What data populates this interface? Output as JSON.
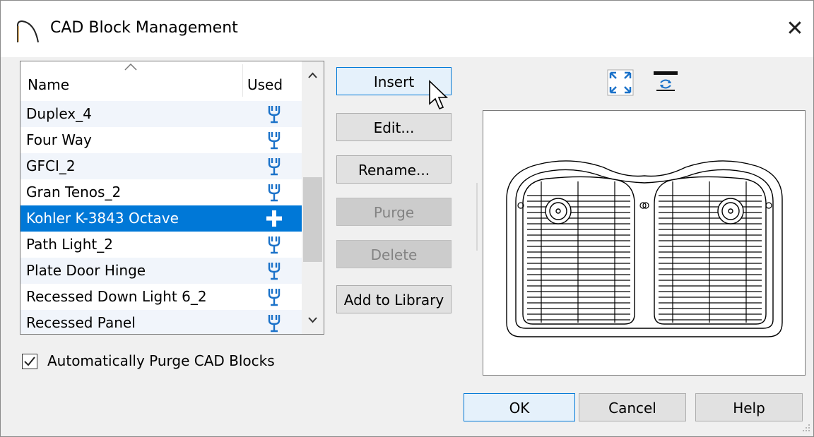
{
  "window": {
    "title": "CAD Block Management",
    "close_glyph": "✕"
  },
  "list": {
    "columns": {
      "name": "Name",
      "used": "Used"
    },
    "rows": [
      {
        "name": "Duplex_4",
        "used_icon": "wrench-used-icon"
      },
      {
        "name": "Four Way",
        "used_icon": "wrench-used-icon"
      },
      {
        "name": "GFCI_2",
        "used_icon": "wrench-used-icon"
      },
      {
        "name": "Gran Tenos_2",
        "used_icon": "wrench-used-icon"
      },
      {
        "name": "Kohler K-3843 Octave",
        "used_icon": "plus-unused-icon",
        "selected": true
      },
      {
        "name": "Path Light_2",
        "used_icon": "wrench-used-icon"
      },
      {
        "name": "Plate Door Hinge",
        "used_icon": "wrench-used-icon"
      },
      {
        "name": "Recessed Down Light 6_2",
        "used_icon": "wrench-used-icon"
      },
      {
        "name": "Recessed Panel",
        "used_icon": "wrench-used-icon"
      }
    ]
  },
  "buttons": {
    "insert": "Insert",
    "edit": "Edit...",
    "rename": "Rename...",
    "purge": "Purge",
    "delete": "Delete",
    "add_to_library": "Add to Library",
    "ok": "OK",
    "cancel": "Cancel",
    "help": "Help"
  },
  "options": {
    "auto_purge_label": "Automatically Purge CAD Blocks",
    "auto_purge_checked": true
  },
  "preview": {
    "tools": [
      "fit-view-icon",
      "rotate-view-icon"
    ],
    "content": "double-sink-drawing"
  },
  "colors": {
    "selection": "#0078d7",
    "icon_blue": "#1b72c9",
    "focus_border": "#0078d7"
  }
}
